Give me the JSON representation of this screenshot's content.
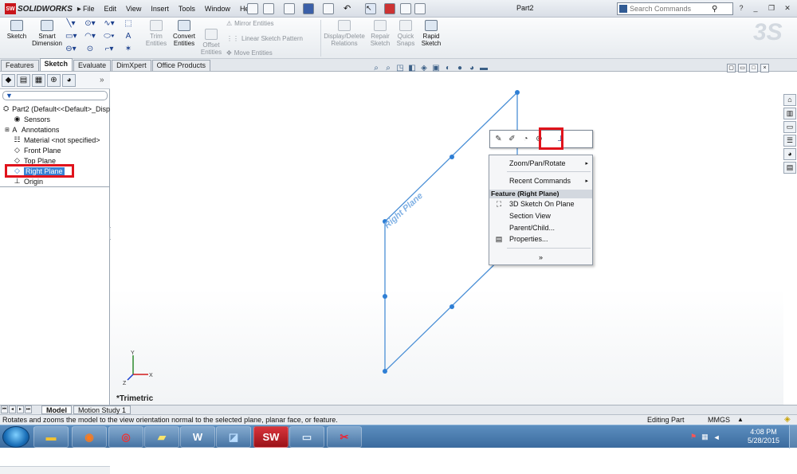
{
  "app": {
    "name": "SOLIDWORKS",
    "doc_title": "Part2"
  },
  "menubar": {
    "items": [
      "File",
      "Edit",
      "View",
      "Insert",
      "Tools",
      "Window",
      "Help"
    ]
  },
  "search": {
    "placeholder": "Search Commands"
  },
  "ribbon": {
    "sketch": "Sketch",
    "smart_dimension": [
      "Smart",
      "Dimension"
    ],
    "trim_entities": [
      "Trim",
      "Entities"
    ],
    "convert_entities": [
      "Convert",
      "Entities"
    ],
    "offset_entities": [
      "Offset",
      "Entities"
    ],
    "mirror_entities": "Mirror Entities",
    "linear_sketch_pattern": "Linear Sketch Pattern",
    "move_entities": "Move Entities",
    "display_delete_relations": [
      "Display/Delete",
      "Relations"
    ],
    "repair_sketch": [
      "Repair",
      "Sketch"
    ],
    "quick_snaps": [
      "Quick",
      "Snaps"
    ],
    "rapid_sketch": [
      "Rapid",
      "Sketch"
    ]
  },
  "command_tabs": [
    "Features",
    "Sketch",
    "Evaluate",
    "DimXpert",
    "Office Products"
  ],
  "active_tab": "Sketch",
  "feature_tree": {
    "root": "Part2  (Default<<Default>_Disp",
    "items": [
      "Sensors",
      "Annotations",
      "Material <not specified>",
      "Front Plane",
      "Top Plane",
      "Right Plane",
      "Origin"
    ],
    "selected": "Right Plane"
  },
  "viewport": {
    "plane_label": "Right Plane",
    "view_name": "*Trimetric"
  },
  "triad": {
    "x": "X",
    "y": "Y",
    "z": "Z"
  },
  "context_menu": {
    "zoom_pan_rotate": "Zoom/Pan/Rotate",
    "recent_commands": "Recent Commands",
    "section_header": "Feature (Right Plane)",
    "sketch_3d_on_plane": "3D Sketch On Plane",
    "section_view": "Section View",
    "parent_child": "Parent/Child...",
    "properties": "Properties...",
    "expand": "»"
  },
  "bottom_tabs": [
    "Model",
    "Motion Study 1"
  ],
  "status": {
    "message": "Rotates and zooms the model to the view orientation normal to the selected plane, planar face, or feature.",
    "mode": "Editing Part",
    "units": "MMGS"
  },
  "taskbar": {
    "time": "4:08 PM",
    "date": "5/28/2015"
  },
  "colors": {
    "plane_edge": "#4a8fd6",
    "highlight_red": "#e0131c",
    "selection_blue": "#3a82d4"
  }
}
